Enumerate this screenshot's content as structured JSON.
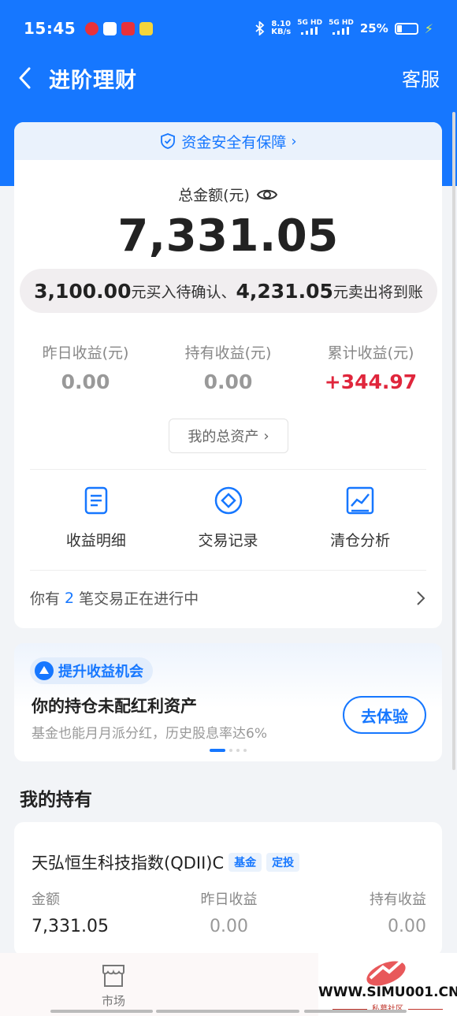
{
  "status_bar": {
    "time": "15:45",
    "net_speed_value": "8.10",
    "net_speed_unit": "KB/s",
    "signal_1": "5G HD",
    "signal_2": "5G HD",
    "battery_percent": 25,
    "battery_text": "25%"
  },
  "header": {
    "title": "进阶理财",
    "service_label": "客服"
  },
  "summary": {
    "safety_text": "资金安全有保障",
    "total_label": "总金额(元)",
    "total_amount": "7,331.05",
    "pending": {
      "buy_amount": "3,100.00",
      "buy_text": "元买入待确认、",
      "sell_amount": "4,231.05",
      "sell_text": "元卖出将到账"
    },
    "earnings": [
      {
        "label": "昨日收益(元)",
        "value": "0.00"
      },
      {
        "label": "持有收益(元)",
        "value": "0.00"
      },
      {
        "label": "累计收益(元)",
        "value": "+344.97"
      }
    ],
    "assets_button": "我的总资产",
    "menu": [
      {
        "label": "收益明细",
        "icon": "document-icon"
      },
      {
        "label": "交易记录",
        "icon": "diamond-circle-icon"
      },
      {
        "label": "清仓分析",
        "icon": "chart-icon"
      }
    ],
    "progress": {
      "prefix": "你有",
      "count": "2",
      "suffix": "笔交易正在进行中"
    }
  },
  "promo": {
    "tag": "提升收益机会",
    "title": "你的持仓未配红利资产",
    "subtitle": "基金也能月月派分红，历史股息率达6%",
    "button": "去体验"
  },
  "holdings": {
    "section_title": "我的持有",
    "fund": {
      "name": "天弘恒生科技指数(QDII)C",
      "tag1": "基金",
      "tag2": "定投",
      "amount_label": "金额",
      "amount": "7,331.05",
      "yesterday_label": "昨日收益",
      "yesterday": "0.00",
      "holding_label": "持有收益",
      "holding": "0.00"
    }
  },
  "bottom_nav": {
    "market_label": "市场"
  },
  "watermark": {
    "site": "WWW.SIMU001.CN",
    "sub": "私募社区"
  },
  "colors": {
    "brand_blue": "#1677ff",
    "profit_red": "#e0263c"
  }
}
